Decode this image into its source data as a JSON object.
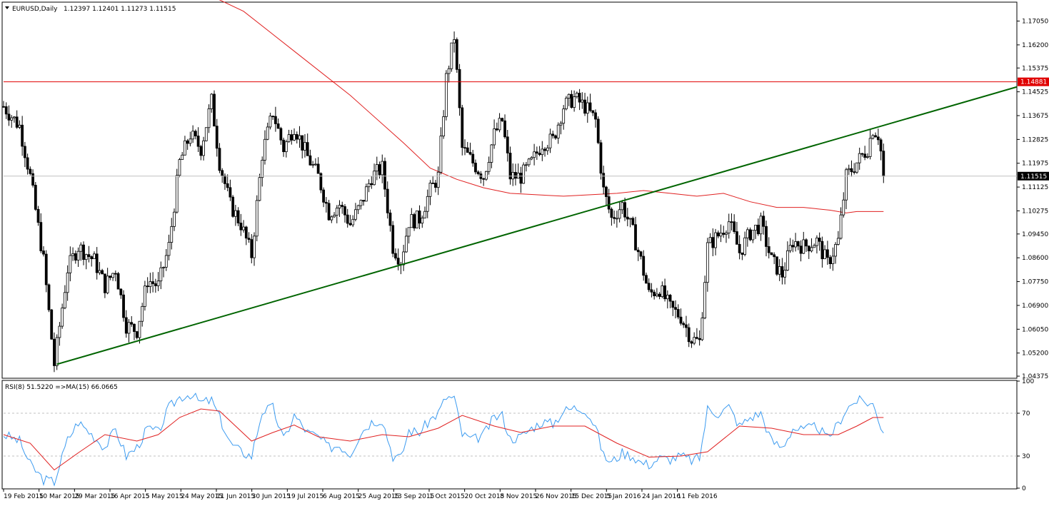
{
  "header": {
    "symbol": "EURUSD,Daily",
    "ohlc": "1.12397 1.12401 1.11273 1.11515"
  },
  "rsi_header": "RSI(8) 51.5220 =>MA(15) 66.0665",
  "colors": {
    "candle": "#000000",
    "ma": "#e02020",
    "trendline": "#006400",
    "resistance": "#e00000",
    "rsi": "#3c9bf0",
    "grid": "#c0c0c0",
    "price_tag_bg": "#000000",
    "resistance_tag_bg": "#e00000"
  },
  "chart_data": [
    {
      "type": "candlestick",
      "symbol": "EURUSD",
      "timeframe": "Daily",
      "ylim": [
        1.043,
        1.177
      ],
      "y_ticks": [
        "1.17050",
        "1.16200",
        "1.15375",
        "1.14525",
        "1.13675",
        "1.12825",
        "1.11975",
        "1.11125",
        "1.10275",
        "1.09450",
        "1.08600",
        "1.07750",
        "1.06900",
        "1.06050",
        "1.05200",
        "1.04375"
      ],
      "x_ticks": [
        "19 Feb 2015",
        "10 Mar 2015",
        "29 Mar 2015",
        "16 Apr 2015",
        "5 May 2015",
        "24 May 2015",
        "11 Jun 2015",
        "30 Jun 2015",
        "19 Jul 2015",
        "6 Aug 2015",
        "25 Aug 2015",
        "13 Sep 2015",
        "1 Oct 2015",
        "20 Oct 2015",
        "8 Nov 2015",
        "26 Nov 2015",
        "15 Dec 2015",
        "5 Jan 2016",
        "24 Jan 2016",
        "11 Feb 2016"
      ],
      "close_path": [
        [
          0,
          1.14
        ],
        [
          6,
          1.133
        ],
        [
          10,
          1.115
        ],
        [
          15,
          1.085
        ],
        [
          19,
          1.048
        ],
        [
          24,
          1.082
        ],
        [
          28,
          1.09
        ],
        [
          34,
          1.085
        ],
        [
          38,
          1.076
        ],
        [
          42,
          1.082
        ],
        [
          46,
          1.062
        ],
        [
          50,
          1.06
        ],
        [
          54,
          1.078
        ],
        [
          58,
          1.076
        ],
        [
          62,
          1.09
        ],
        [
          66,
          1.12
        ],
        [
          70,
          1.13
        ],
        [
          74,
          1.125
        ],
        [
          78,
          1.142
        ],
        [
          81,
          1.12
        ],
        [
          85,
          1.105
        ],
        [
          89,
          1.098
        ],
        [
          93,
          1.087
        ],
        [
          97,
          1.123
        ],
        [
          101,
          1.138
        ],
        [
          105,
          1.125
        ],
        [
          109,
          1.133
        ],
        [
          114,
          1.122
        ],
        [
          118,
          1.115
        ],
        [
          122,
          1.102
        ],
        [
          126,
          1.105
        ],
        [
          130,
          1.098
        ],
        [
          134,
          1.105
        ],
        [
          138,
          1.115
        ],
        [
          142,
          1.118
        ],
        [
          146,
          1.09
        ],
        [
          149,
          1.085
        ],
        [
          152,
          1.099
        ],
        [
          156,
          1.1
        ],
        [
          160,
          1.11
        ],
        [
          163,
          1.115
        ],
        [
          166,
          1.15
        ],
        [
          169,
          1.165
        ],
        [
          172,
          1.125
        ],
        [
          176,
          1.12
        ],
        [
          180,
          1.115
        ],
        [
          184,
          1.13
        ],
        [
          187,
          1.135
        ],
        [
          190,
          1.115
        ],
        [
          194,
          1.115
        ],
        [
          198,
          1.12
        ],
        [
          202,
          1.127
        ],
        [
          206,
          1.128
        ],
        [
          210,
          1.14
        ],
        [
          214,
          1.143
        ],
        [
          218,
          1.14
        ],
        [
          222,
          1.135
        ],
        [
          225,
          1.11
        ],
        [
          228,
          1.1
        ],
        [
          232,
          1.105
        ],
        [
          236,
          1.095
        ],
        [
          239,
          1.085
        ],
        [
          242,
          1.073
        ],
        [
          246,
          1.075
        ],
        [
          250,
          1.068
        ],
        [
          254,
          1.065
        ],
        [
          258,
          1.057
        ],
        [
          261,
          1.056
        ],
        [
          264,
          1.09
        ],
        [
          268,
          1.094
        ],
        [
          272,
          1.099
        ],
        [
          276,
          1.088
        ],
        [
          280,
          1.095
        ],
        [
          284,
          1.098
        ],
        [
          288,
          1.085
        ],
        [
          292,
          1.08
        ],
        [
          296,
          1.092
        ],
        [
          300,
          1.09
        ],
        [
          305,
          1.092
        ],
        [
          309,
          1.084
        ],
        [
          313,
          1.092
        ],
        [
          316,
          1.115
        ],
        [
          320,
          1.12
        ],
        [
          324,
          1.125
        ],
        [
          326,
          1.132
        ],
        [
          328,
          1.13
        ],
        [
          329,
          1.124
        ],
        [
          330,
          1.1151
        ]
      ],
      "ma_path": [
        [
          70,
          1.183
        ],
        [
          90,
          1.174
        ],
        [
          110,
          1.159
        ],
        [
          130,
          1.144
        ],
        [
          150,
          1.127
        ],
        [
          160,
          1.118
        ],
        [
          170,
          1.114
        ],
        [
          180,
          1.111
        ],
        [
          190,
          1.109
        ],
        [
          210,
          1.108
        ],
        [
          230,
          1.109
        ],
        [
          240,
          1.11
        ],
        [
          250,
          1.109
        ],
        [
          260,
          1.108
        ],
        [
          270,
          1.109
        ],
        [
          280,
          1.106
        ],
        [
          290,
          1.104
        ],
        [
          300,
          1.104
        ],
        [
          310,
          1.103
        ],
        [
          316,
          1.102
        ],
        [
          320,
          1.1025
        ],
        [
          330,
          1.1025
        ]
      ],
      "trendline": [
        [
          20,
          1.048
        ],
        [
          380,
          1.147
        ]
      ],
      "resistance_level": 1.14881,
      "resistance_label": "1.14881",
      "current_price": 1.11515,
      "current_price_label": "1.11515"
    },
    {
      "type": "line",
      "title": "RSI(8) 51.5220 =>MA(15) 66.0665",
      "ylim": [
        0,
        100
      ],
      "y_ticks": [
        "100",
        "70",
        "30",
        "0"
      ],
      "levels": [
        70,
        30
      ],
      "series": [
        {
          "name": "RSI(8)",
          "values": [
            [
              0,
              50
            ],
            [
              6,
              44
            ],
            [
              10,
              22
            ],
            [
              15,
              8
            ],
            [
              19,
              6
            ],
            [
              24,
              45
            ],
            [
              28,
              62
            ],
            [
              34,
              48
            ],
            [
              38,
              38
            ],
            [
              42,
              55
            ],
            [
              46,
              30
            ],
            [
              50,
              38
            ],
            [
              54,
              56
            ],
            [
              58,
              52
            ],
            [
              62,
              75
            ],
            [
              66,
              85
            ],
            [
              70,
              88
            ],
            [
              74,
              80
            ],
            [
              78,
              82
            ],
            [
              81,
              66
            ],
            [
              85,
              42
            ],
            [
              89,
              34
            ],
            [
              93,
              30
            ],
            [
              97,
              72
            ],
            [
              101,
              75
            ],
            [
              105,
              45
            ],
            [
              109,
              68
            ],
            [
              114,
              52
            ],
            [
              118,
              48
            ],
            [
              122,
              38
            ],
            [
              126,
              40
            ],
            [
              130,
              32
            ],
            [
              134,
              52
            ],
            [
              138,
              62
            ],
            [
              142,
              64
            ],
            [
              146,
              30
            ],
            [
              149,
              28
            ],
            [
              152,
              54
            ],
            [
              156,
              52
            ],
            [
              160,
              64
            ],
            [
              163,
              70
            ],
            [
              166,
              85
            ],
            [
              169,
              84
            ],
            [
              172,
              50
            ],
            [
              176,
              45
            ],
            [
              180,
              50
            ],
            [
              184,
              66
            ],
            [
              187,
              68
            ],
            [
              190,
              46
            ],
            [
              194,
              48
            ],
            [
              198,
              56
            ],
            [
              202,
              62
            ],
            [
              206,
              60
            ],
            [
              210,
              72
            ],
            [
              214,
              75
            ],
            [
              218,
              74
            ],
            [
              222,
              58
            ],
            [
              225,
              30
            ],
            [
              228,
              24
            ],
            [
              232,
              33
            ],
            [
              236,
              30
            ],
            [
              239,
              24
            ],
            [
              242,
              22
            ],
            [
              246,
              28
            ],
            [
              250,
              27
            ],
            [
              254,
              30
            ],
            [
              258,
              26
            ],
            [
              261,
              28
            ],
            [
              264,
              74
            ],
            [
              268,
              70
            ],
            [
              272,
              76
            ],
            [
              276,
              58
            ],
            [
              280,
              66
            ],
            [
              284,
              70
            ],
            [
              288,
              44
            ],
            [
              292,
              38
            ],
            [
              296,
              56
            ],
            [
              300,
              54
            ],
            [
              305,
              58
            ],
            [
              309,
              46
            ],
            [
              313,
              60
            ],
            [
              316,
              74
            ],
            [
              320,
              82
            ],
            [
              324,
              80
            ],
            [
              326,
              78
            ],
            [
              328,
              66
            ],
            [
              329,
              58
            ],
            [
              330,
              51.5
            ]
          ]
        },
        {
          "name": "MA(15)",
          "values": [
            [
              0,
              50
            ],
            [
              10,
              42
            ],
            [
              19,
              17
            ],
            [
              28,
              33
            ],
            [
              38,
              50
            ],
            [
              50,
              44
            ],
            [
              58,
              50
            ],
            [
              66,
              66
            ],
            [
              74,
              74
            ],
            [
              81,
              72
            ],
            [
              93,
              44
            ],
            [
              101,
              52
            ],
            [
              109,
              59
            ],
            [
              118,
              48
            ],
            [
              130,
              44
            ],
            [
              142,
              50
            ],
            [
              152,
              48
            ],
            [
              163,
              56
            ],
            [
              172,
              68
            ],
            [
              184,
              58
            ],
            [
              194,
              52
            ],
            [
              206,
              58
            ],
            [
              218,
              58
            ],
            [
              230,
              42
            ],
            [
              242,
              29
            ],
            [
              254,
              30
            ],
            [
              264,
              34
            ],
            [
              276,
              58
            ],
            [
              288,
              56
            ],
            [
              300,
              50
            ],
            [
              313,
              50
            ],
            [
              320,
              58
            ],
            [
              326,
              66
            ],
            [
              330,
              66
            ]
          ]
        }
      ]
    }
  ]
}
